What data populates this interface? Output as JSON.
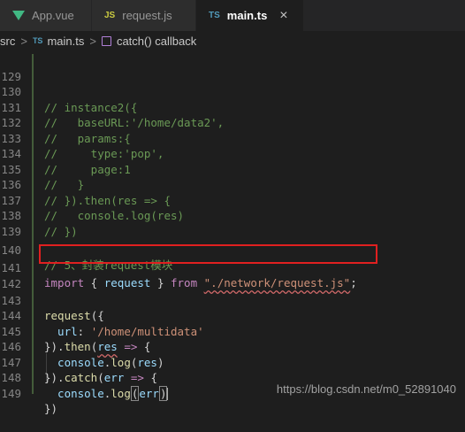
{
  "tabs": [
    {
      "label": "App.vue",
      "icon": "vue-icon"
    },
    {
      "label": "request.js",
      "icon": "js-icon",
      "badge": "JS"
    },
    {
      "label": "main.ts",
      "icon": "ts-icon",
      "badge": "TS",
      "active": true,
      "close": "×"
    }
  ],
  "breadcrumb": {
    "folder": "src",
    "sep": ">",
    "file_badge": "TS",
    "file": "main.ts",
    "symbol": "catch() callback"
  },
  "code_lines": [
    {
      "num": "129"
    },
    {
      "num": "130"
    },
    {
      "num": "131"
    },
    {
      "num": "132"
    },
    {
      "num": "133"
    },
    {
      "num": "134"
    },
    {
      "num": "135"
    },
    {
      "num": "136"
    },
    {
      "num": "137"
    },
    {
      "num": "138"
    },
    {
      "num": "139"
    },
    {
      "num": "140"
    },
    {
      "num": "141"
    },
    {
      "num": "142"
    },
    {
      "num": "143"
    },
    {
      "num": "144"
    },
    {
      "num": "145"
    },
    {
      "num": "146"
    },
    {
      "num": "147"
    },
    {
      "num": "148"
    },
    {
      "num": "149"
    }
  ],
  "code": {
    "l130": "// instance2({",
    "l131": "//   baseURL:'/home/data2',",
    "l132": "//   params:{",
    "l133": "//     type:'pop',",
    "l134": "//     page:1",
    "l135": "//   }",
    "l136": "// }).then(res => {",
    "l137": "//   console.log(res)",
    "l138": "// })",
    "l140": "// 5、封装request模块",
    "l141_import": "import",
    "l141_open": " { ",
    "l141_id": "request",
    "l141_close": " } ",
    "l141_from": "from",
    "l141_space": " ",
    "l141_str": "\"./network/request.js\"",
    "l141_semi": ";",
    "l143_fn": "request",
    "l143_p": "({",
    "l144_key": "  url",
    "l144_colon": ": ",
    "l144_str": "'/home/multidata'",
    "l145_a": "}).",
    "l145_fn": "then",
    "l145_b": "(",
    "l145_id": "res",
    "l145_arrow": " => ",
    "l145_c": "{",
    "l146_id": "  console",
    "l146_dot": ".",
    "l146_fn": "log",
    "l146_a": "(",
    "l146_arg": "res",
    "l146_b": ")",
    "l147_a": "}).",
    "l147_fn": "catch",
    "l147_b": "(",
    "l147_id": "err",
    "l147_arrow": " => ",
    "l147_c": "{",
    "l148_id": "  console",
    "l148_dot": ".",
    "l148_fn": "log",
    "l148_a": "(",
    "l148_arg": "err",
    "l148_b": ")",
    "l149": "})"
  },
  "watermark": "https://blog.csdn.net/m0_52891040",
  "colors": {
    "background": "#1e1e1e",
    "comment": "#6a9955",
    "keyword": "#c586c0",
    "string": "#ce9178",
    "highlight_box": "#e02020"
  }
}
